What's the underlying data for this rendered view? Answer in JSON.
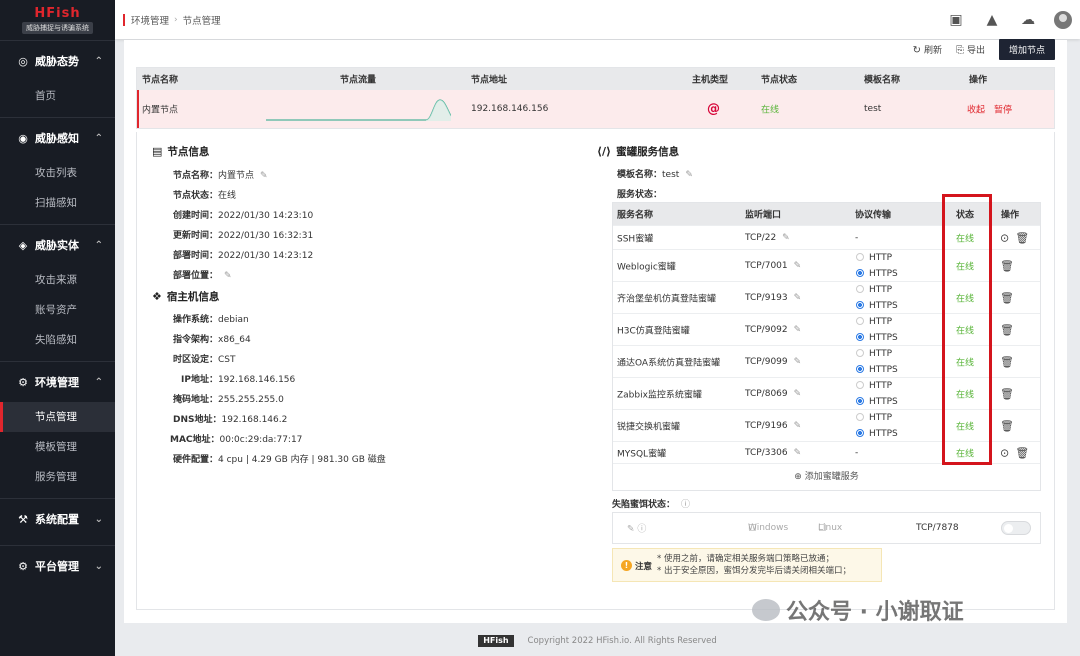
{
  "brand": {
    "title": "HFish",
    "subtitle": "威胁捕捉与诱骗系统"
  },
  "sidebar": {
    "groups": [
      {
        "icon": "dashboard-icon",
        "label": "威胁态势",
        "items": [
          "首页"
        ]
      },
      {
        "icon": "radar-icon",
        "label": "威胁感知",
        "items": [
          "攻击列表",
          "扫描感知"
        ]
      },
      {
        "icon": "target-icon",
        "label": "威胁实体",
        "items": [
          "攻击来源",
          "账号资产",
          "失陷感知"
        ]
      },
      {
        "icon": "gear-icon",
        "label": "环境管理",
        "items": [
          "节点管理",
          "模板管理",
          "服务管理"
        ]
      },
      {
        "icon": "config-icon",
        "label": "系统配置",
        "items": []
      },
      {
        "icon": "platform-icon",
        "label": "平台管理",
        "items": []
      }
    ],
    "active_item": "节点管理"
  },
  "breadcrumb": {
    "parent": "环境管理",
    "current": "节点管理"
  },
  "toolbar": {
    "refresh": "刷新",
    "export": "导出",
    "add_node": "增加节点"
  },
  "node_table": {
    "headers": {
      "name": "节点名称",
      "traffic": "节点流量",
      "address": "节点地址",
      "host_type": "主机类型",
      "status": "节点状态",
      "template": "模板名称",
      "actions": "操作"
    },
    "row": {
      "name": "内置节点",
      "address": "192.168.146.156",
      "status": "在线",
      "template": "test",
      "collapse": "收起",
      "pause": "暂停"
    }
  },
  "node_info": {
    "title": "节点信息",
    "fields": [
      {
        "k": "节点名称：",
        "v": "内置节点",
        "editable": true
      },
      {
        "k": "节点状态：",
        "v": "在线"
      },
      {
        "k": "创建时间：",
        "v": "2022/01/30 14:23:10"
      },
      {
        "k": "更新时间：",
        "v": "2022/01/30 16:32:31"
      },
      {
        "k": "部署时间：",
        "v": "2022/01/30 14:23:12"
      },
      {
        "k": "部署位置：",
        "v": "",
        "editable": true
      }
    ]
  },
  "host_info": {
    "title": "宿主机信息",
    "fields": [
      {
        "k": "操作系统：",
        "v": "debian"
      },
      {
        "k": "指令架构：",
        "v": "x86_64"
      },
      {
        "k": "时区设定：",
        "v": "CST"
      },
      {
        "k": "IP地址：",
        "v": "192.168.146.156"
      },
      {
        "k": "掩码地址：",
        "v": "255.255.255.0"
      },
      {
        "k": "DNS地址：",
        "v": "192.168.146.2"
      },
      {
        "k": "MAC地址：",
        "v": "00:0c:29:da:77:17"
      },
      {
        "k": "硬件配置：",
        "v": "4 cpu | 4.29 GB 内存 | 981.30 GB 磁盘"
      }
    ]
  },
  "honeypot": {
    "title": "蜜罐服务信息",
    "template_label": "模板名称：",
    "template_value": "test",
    "service_status_label": "服务状态：",
    "headers": {
      "name": "服务名称",
      "port": "监听端口",
      "proto": "协议传输",
      "status": "状态",
      "actions": "操作"
    },
    "rows": [
      {
        "name": "SSH蜜罐",
        "port": "TCP/22",
        "proto": "-",
        "status": "在线",
        "target": true
      },
      {
        "name": "Weblogic蜜罐",
        "port": "TCP/7001",
        "proto": [
          "HTTP",
          "HTTPS"
        ],
        "status": "在线"
      },
      {
        "name": "齐治堡垒机仿真登陆蜜罐",
        "port": "TCP/9193",
        "proto": [
          "HTTP",
          "HTTPS"
        ],
        "status": "在线"
      },
      {
        "name": "H3C仿真登陆蜜罐",
        "port": "TCP/9092",
        "proto": [
          "HTTP",
          "HTTPS"
        ],
        "status": "在线"
      },
      {
        "name": "通达OA系统仿真登陆蜜罐",
        "port": "TCP/9099",
        "proto": [
          "HTTP",
          "HTTPS"
        ],
        "status": "在线"
      },
      {
        "name": "Zabbix监控系统蜜罐",
        "port": "TCP/8069",
        "proto": [
          "HTTP",
          "HTTPS"
        ],
        "status": "在线"
      },
      {
        "name": "锐捷交换机蜜罐",
        "port": "TCP/9196",
        "proto": [
          "HTTP",
          "HTTPS"
        ],
        "status": "在线"
      },
      {
        "name": "MYSQL蜜罐",
        "port": "TCP/3306",
        "proto": "-",
        "status": "在线",
        "target": true
      }
    ],
    "add_label": "添加蜜罐服务"
  },
  "trap": {
    "label": "失陷蜜饵状态：",
    "windows": "Windows",
    "linux": "Linux",
    "port": "TCP/7878"
  },
  "notice": {
    "label": "注意",
    "lines": [
      "* 使用之前，请确定相关服务端口策略已放通；",
      "* 出于安全原因，蜜饵分发完毕后请关闭相关端口；"
    ]
  },
  "footer": {
    "logo": "HFish",
    "copyright": "Copyright 2022 HFish.io. All Rights Reserved"
  },
  "watermark": "公众号 · 小谢取证",
  "colors": {
    "accent": "#e0262d",
    "online": "#58b438",
    "sidebar": "#181c24",
    "highlight_box": "#d4141c"
  }
}
